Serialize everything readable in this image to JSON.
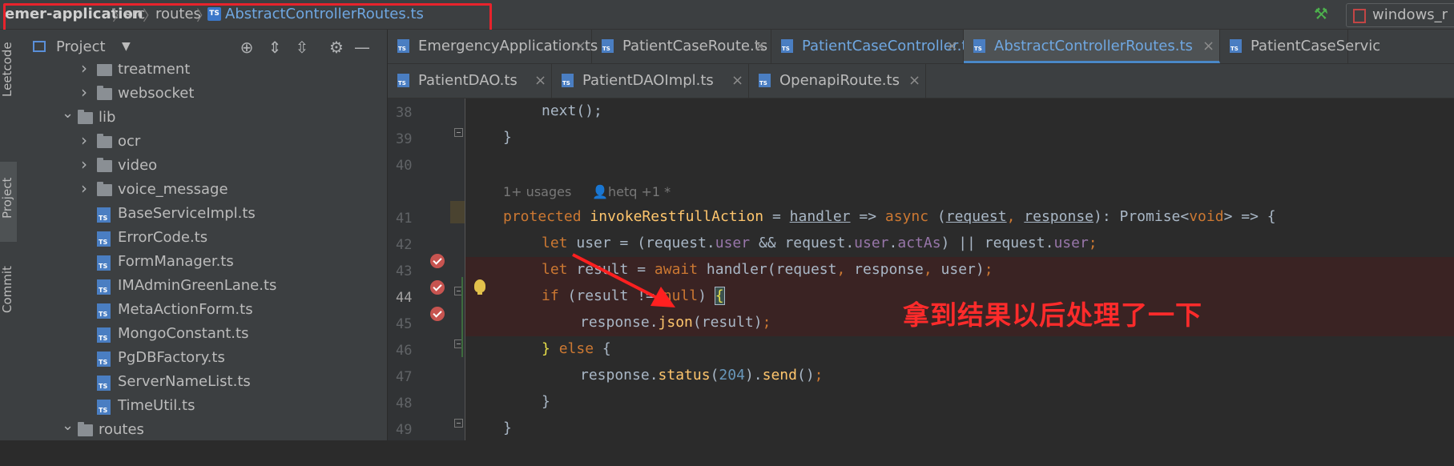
{
  "breadcrumb": {
    "project": "emer-application",
    "segments": [
      "src",
      "routes"
    ],
    "file": "AbstractControllerRoutes.ts",
    "separator": "〉"
  },
  "toolbar": {
    "run_config": "windows_r"
  },
  "left_stripe": {
    "tabs": [
      "Leetcode",
      "Project",
      "Commit"
    ]
  },
  "project_panel": {
    "title": "Project",
    "tree": [
      {
        "label": "treatment",
        "type": "folder",
        "depth": 2,
        "expanded": false
      },
      {
        "label": "websocket",
        "type": "folder",
        "depth": 2,
        "expanded": false
      },
      {
        "label": "lib",
        "type": "folder",
        "depth": 1,
        "expanded": true
      },
      {
        "label": "ocr",
        "type": "folder",
        "depth": 2,
        "expanded": false
      },
      {
        "label": "video",
        "type": "folder",
        "depth": 2,
        "expanded": false
      },
      {
        "label": "voice_message",
        "type": "folder",
        "depth": 2,
        "expanded": false
      },
      {
        "label": "BaseServiceImpl.ts",
        "type": "file",
        "depth": 2
      },
      {
        "label": "ErrorCode.ts",
        "type": "file",
        "depth": 2
      },
      {
        "label": "FormManager.ts",
        "type": "file",
        "depth": 2
      },
      {
        "label": "IMAdminGreenLane.ts",
        "type": "file",
        "depth": 2
      },
      {
        "label": "MetaActionForm.ts",
        "type": "file",
        "depth": 2
      },
      {
        "label": "MongoConstant.ts",
        "type": "file",
        "depth": 2
      },
      {
        "label": "PgDBFactory.ts",
        "type": "file",
        "depth": 2
      },
      {
        "label": "ServerNameList.ts",
        "type": "file",
        "depth": 2
      },
      {
        "label": "TimeUtil.ts",
        "type": "file",
        "depth": 2
      },
      {
        "label": "routes",
        "type": "folder",
        "depth": 1,
        "expanded": true
      }
    ]
  },
  "tabs": {
    "row1": [
      {
        "label": "EmergencyApplication.ts",
        "active": false,
        "blue": false
      },
      {
        "label": "PatientCaseRoute.ts",
        "active": false,
        "blue": false
      },
      {
        "label": "PatientCaseController.ts",
        "active": false,
        "blue": true
      },
      {
        "label": "AbstractControllerRoutes.ts",
        "active": true,
        "blue": true
      },
      {
        "label": "PatientCaseServic",
        "active": false,
        "blue": false
      }
    ],
    "row2": [
      {
        "label": "PatientDAO.ts",
        "active": false
      },
      {
        "label": "PatientDAOImpl.ts",
        "active": false
      },
      {
        "label": "OpenapiRoute.ts",
        "active": false
      }
    ],
    "close_glyph": "×"
  },
  "editor": {
    "line_numbers": [
      "38",
      "39",
      "40",
      "",
      "41",
      "42",
      "43",
      "44",
      "45",
      "46",
      "47",
      "48",
      "49"
    ],
    "usages_hint": "1+ usages",
    "author_hint": "hetq +1 *",
    "annotation": "拿到结果以后处理了一下"
  },
  "colors": {
    "keyword": "#cc7832",
    "function": "#ffc66d",
    "property": "#9876aa",
    "number": "#6897bb",
    "annotation": "#ff2b2b",
    "breakpoint": "#c75450",
    "highlight_box": "#e8232c"
  },
  "icons": [
    "hammer-icon",
    "run-config-icon",
    "project-window-icon",
    "target-icon",
    "expand-all-icon",
    "collapse-all-icon",
    "gear-icon",
    "minimize-icon",
    "folder-icon",
    "ts-file-icon",
    "breakpoint-icon",
    "fold-icon",
    "lightbulb-icon",
    "arrow-annotation"
  ]
}
